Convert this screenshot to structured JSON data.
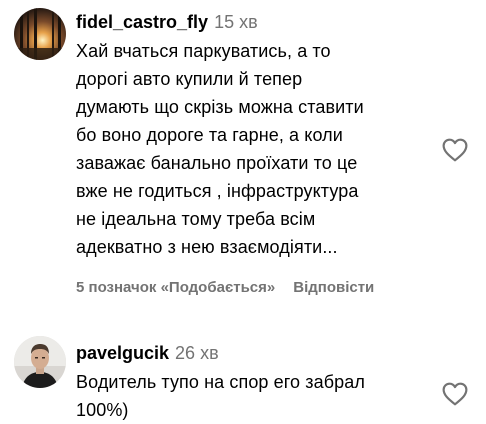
{
  "comments": [
    {
      "username": "fidel_castro_fly",
      "time": "15 хв",
      "text": "Хай вчаться паркуватись, а то\nдорогі авто купили й тепер\nдумають що скрізь можна ставити\nбо воно дороге та гарне, а коли\nзаважає банально проїхати то це\nвже не годиться , інфраструктура\nне ідеальна тому треба всім\nадекватно з нею взаємодіяти...",
      "likes_label": "5 позначок «Подобається»",
      "reply_label": "Відповісти",
      "avatar_icon": "sunset-forest-avatar",
      "like_icon": "heart-outline-icon"
    },
    {
      "username": "pavelgucik",
      "time": "26 хв",
      "text": "Водитель тупо на спор его забрал\n100%)",
      "avatar_icon": "person-photo-avatar",
      "like_icon": "heart-outline-icon"
    }
  ],
  "colors": {
    "text": "#000000",
    "secondary": "#737373",
    "background": "#ffffff"
  }
}
